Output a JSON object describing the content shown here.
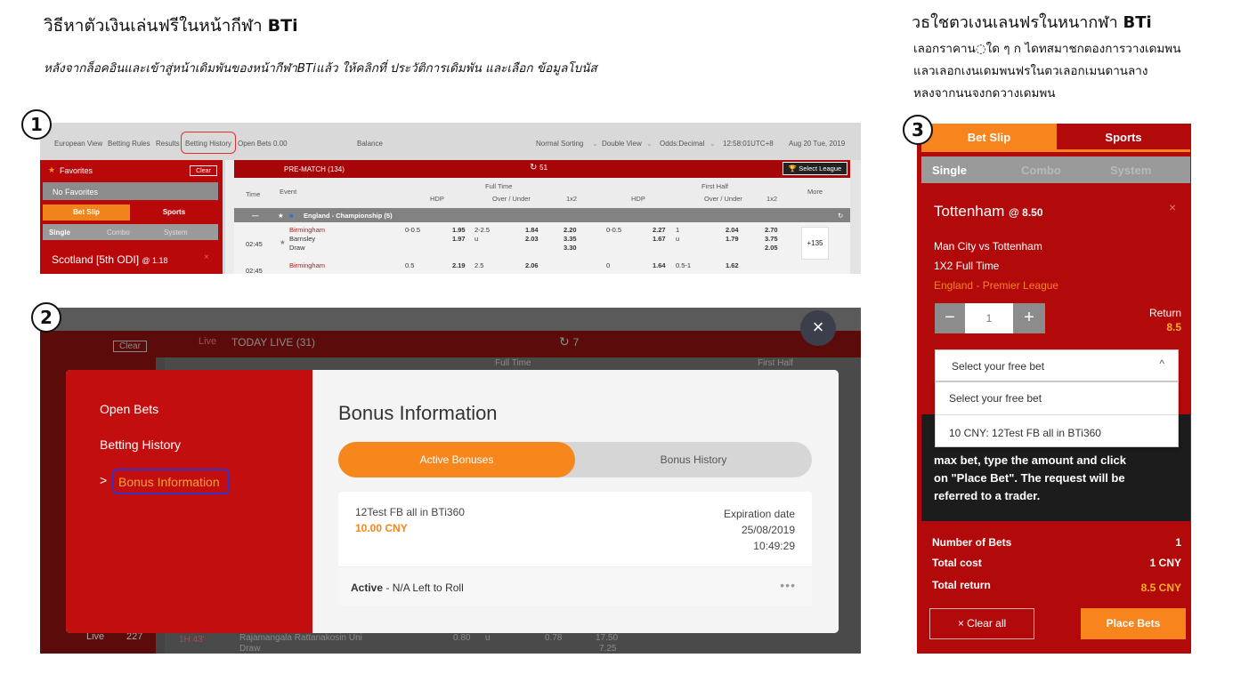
{
  "left_title": {
    "text": "วิธีหาตัวเงินเล่นฟรีในหน้ากีฬา",
    "brand": "BTi"
  },
  "left_subtitle": "หลังจากล็อคอินและเข้าสู่หน้าเดิมพันของหน้ากีฬาBTiแล้ว ให้คลิกที่ ประวัติการเดิมพัน  และเลือก ข้อมูลโบนัส",
  "right_title": {
    "text": "วธใชตวเงนเลนฟรในหนากฬา",
    "brand": "BTi"
  },
  "right_desc": [
    "เลอกราคาน◌ใด ๆ ก ไดทสมาชกตองการวางเดมพน",
    "แลวเลอกเงนเดมพนฟรในตวเลอกเมนดานลาง",
    "หลงจากนนจงกดวางเดมพน"
  ],
  "steps": {
    "one": "1",
    "two": "2",
    "three": "3"
  },
  "panel1": {
    "topbar": {
      "european_view": "European View",
      "betting_rules": "Betting Rules",
      "results": "Results",
      "betting_history": "Betting History",
      "open_bets": "Open Bets 0.00",
      "balance": "Balance",
      "sorting": "Normal Sorting",
      "view": "Double View",
      "odds": "Odds:Decimal",
      "time": "12:58:01UTC+8",
      "date": "Aug 20 Tue, 2019"
    },
    "sidebar": {
      "favorites": "Favorites",
      "clear": "Clear",
      "no_favorites": "No Favorites",
      "bet_slip": "Bet Slip",
      "sports": "Sports",
      "single": "Single",
      "combo": "Combo",
      "system": "System",
      "selection": "Scotland [5th ODI]",
      "selection_odds": "@ 1.18",
      "close": "×"
    },
    "main": {
      "prematch": "PRE-MATCH (134)",
      "refresh_count": "51",
      "select_league": "Select League",
      "headers": {
        "time": "Time",
        "event": "Event",
        "full_time": "Full Time",
        "first_half": "First Half",
        "hdp": "HDP",
        "over_under": "Over / Under",
        "one_x_two": "1x2",
        "more": "More"
      },
      "league": "England - Championship (5)",
      "rows": [
        {
          "time": "02:45",
          "home": "Birmingham",
          "away": "Barnsley",
          "draw": "Draw",
          "ft_hdp": "0-0.5",
          "ft_hdp_o1": "1.95",
          "ft_hdp_o2": "1.97",
          "ft_ou": "2-2.5",
          "ft_ou_u": "u",
          "ft_ou_o1": "1.84",
          "ft_ou_o2": "2.03",
          "ft_1x2_1": "2.20",
          "ft_1x2_2": "3.35",
          "ft_1x2_3": "3.30",
          "fh_hdp": "0-0.5",
          "fh_hdp_o1": "2.27",
          "fh_hdp_o2": "1.67",
          "fh_ou": "1",
          "fh_ou_u": "u",
          "fh_ou_o1": "2.04",
          "fh_ou_o2": "1.79",
          "fh_1x2_1": "2.70",
          "fh_1x2_2": "3.75",
          "fh_1x2_3": "2.05",
          "more": "+135"
        },
        {
          "time": "02:45",
          "home": "Birmingham",
          "ft_hdp": "0.5",
          "ft_hdp_o1": "2.19",
          "ft_ou": "2.5",
          "ft_ou_o1": "2.06",
          "fh_hdp": "0",
          "fh_hdp_o1": "1.64",
          "fh_ou": "0.5-1",
          "fh_ou_o1": "1.62"
        }
      ]
    }
  },
  "panel2": {
    "background": {
      "clear": "Clear",
      "live": "Live",
      "today_live": "TODAY LIVE (31)",
      "refresh_count": "7",
      "full_time": "Full Time",
      "first_half": "First Half",
      "live_bottom": "Live",
      "live_count": "227",
      "bottom_time": "1H 43'",
      "bottom_team": "Rajamangala Rattanakosin Uni",
      "bottom_draw": "Draw",
      "bottom_o1": "0.80",
      "bottom_u": "u",
      "bottom_o2": "0.78",
      "bottom_o3": "17.50",
      "bottom_o4": "7.25"
    },
    "close": "×",
    "menu": {
      "open_bets": "Open Bets",
      "betting_history": "Betting History",
      "arrow": ">",
      "bonus_information": "Bonus Information"
    },
    "content": {
      "title": "Bonus Information",
      "tab_active": "Active Bonuses",
      "tab_history": "Bonus History",
      "bonus_name": "12Test FB all in BTi360",
      "bonus_amount": "10.00 CNY",
      "expiration_label": "Expiration date",
      "expiration_date": "25/08/2019",
      "expiration_time": "10:49:29",
      "status": "Active",
      "status_detail": " - N/A Left to Roll",
      "more": "•••"
    }
  },
  "panel3": {
    "bet_slip": "Bet Slip",
    "sports": "Sports",
    "single": "Single",
    "combo": "Combo",
    "system": "System",
    "team": "Tottenham",
    "odds": "@ 8.50",
    "close": "×",
    "match": "Man City  vs  Tottenham",
    "bet_type": "1X2 Full Time",
    "league": "England - Premier League",
    "minus": "−",
    "quantity": "1",
    "plus": "+",
    "return_label": "Return",
    "return_value": "8.5",
    "free_bet_select": "Select your free bet",
    "caret": "^",
    "options": [
      "Select your free bet",
      "10 CNY: 12Test FB all in BTi360"
    ],
    "info_line1": "max bet, type the amount and click",
    "info_line2": "on \"Place Bet\". The request will be",
    "info_line3": "referred to a trader.",
    "number_of_bets_label": "Number of Bets",
    "number_of_bets": "1",
    "total_cost_label": "Total cost",
    "total_cost": "1 CNY",
    "total_return_label": "Total return",
    "total_return": "8.5 CNY",
    "clear_all": "× Clear all",
    "place_bets": "Place Bets"
  },
  "colors": {
    "brand_red": "#b20a0a",
    "accent_orange": "#f7841c",
    "highlight_blue": "#3431c9",
    "highlight_red": "#e0312f"
  }
}
